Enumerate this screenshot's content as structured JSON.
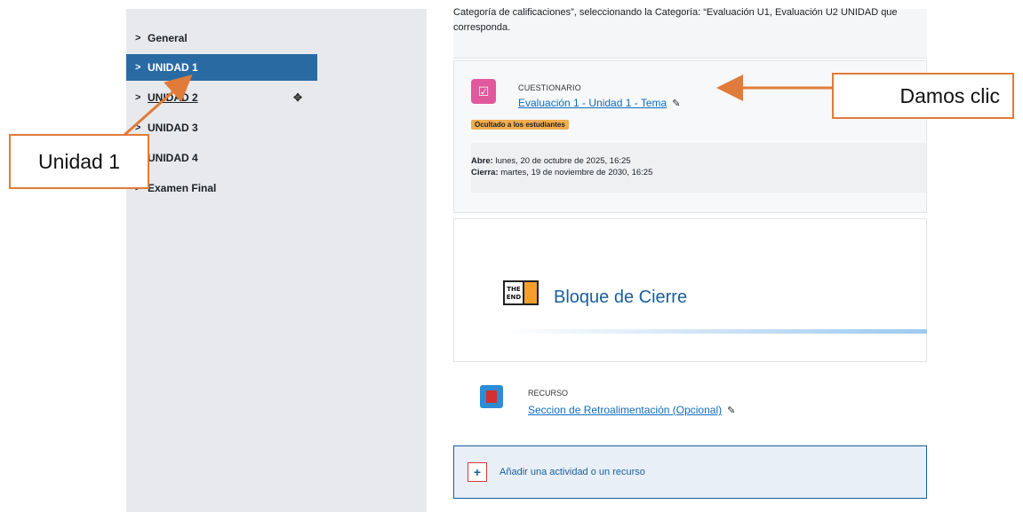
{
  "nav": {
    "items": [
      {
        "label": "General"
      },
      {
        "label": "UNIDAD 1"
      },
      {
        "label": "UNIDAD 2"
      },
      {
        "label": "UNIDAD 3"
      },
      {
        "label": "UNIDAD 4"
      },
      {
        "label": "Examen Final"
      }
    ]
  },
  "main": {
    "top_text": "Categoría de calificaciones”, seleccionando la Categoría: “Evaluación U1, Evaluación U2 UNIDAD que corresponda.",
    "quiz": {
      "kind": "CUESTIONARIO",
      "title": "Evaluación 1 - Unidad 1 - Tema",
      "badge": "Ocultado a los estudiantes",
      "opens_label": "Abre:",
      "opens_value": " lunes, 20 de octubre de 2025, 16:25",
      "closes_label": "Cierra:",
      "closes_value": " martes, 19 de noviembre de 2030, 16:25"
    },
    "closing": {
      "icon_text_1": "THE",
      "icon_text_2": "END",
      "title": "Bloque de Cierre"
    },
    "resource": {
      "kind": "RECURSO",
      "title": "Seccion de Retroalimentación (Opcional)"
    },
    "add_activity": "Añadir una actividad o un recurso"
  },
  "annotations": {
    "left_callout": "Unidad 1",
    "right_callout": "Damos clic",
    "color": "#e07b39"
  },
  "colors": {
    "nav_active": "#2a6aa3",
    "link": "#0f6cbf",
    "quiz_icon": "#e2589c",
    "badge": "#f0ad4e"
  }
}
